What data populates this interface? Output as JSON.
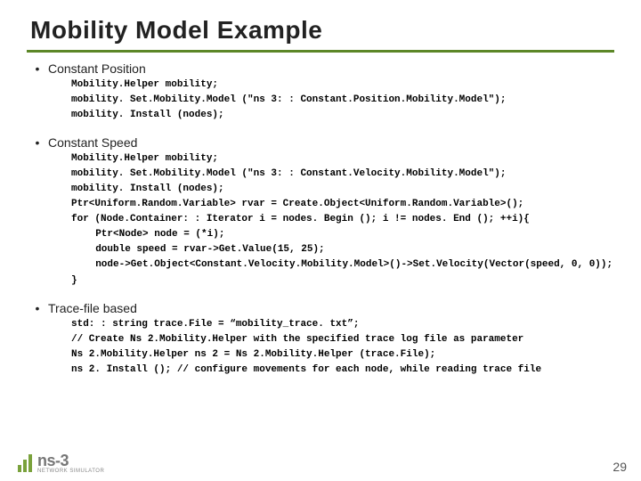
{
  "title": "Mobility Model Example",
  "sections": [
    {
      "label": "Constant Position",
      "code": [
        "Mobility.Helper mobility;",
        "mobility. Set.Mobility.Model (\"ns 3: : Constant.Position.Mobility.Model\");",
        "mobility. Install (nodes);"
      ]
    },
    {
      "label": "Constant Speed",
      "code": [
        "Mobility.Helper mobility;",
        "mobility. Set.Mobility.Model (\"ns 3: : Constant.Velocity.Mobility.Model\");",
        "mobility. Install (nodes);",
        "Ptr<Uniform.Random.Variable> rvar = Create.Object<Uniform.Random.Variable>();",
        "for (Node.Container: : Iterator i = nodes. Begin (); i != nodes. End (); ++i){",
        "  Ptr<Node> node = (*i);",
        "  double speed = rvar->Get.Value(15, 25);",
        "  node->Get.Object<Constant.Velocity.Mobility.Model>()->Set.Velocity(Vector(speed, 0, 0));",
        "}"
      ]
    },
    {
      "label": "Trace-file based",
      "code": [
        "std: : string trace.File = “mobility_trace. txt”;",
        "// Create Ns 2.Mobility.Helper with the specified trace log file as parameter",
        "Ns 2.Mobility.Helper ns 2 = Ns 2.Mobility.Helper (trace.File);",
        "ns 2. Install (); // configure movements for each node, while reading trace file"
      ]
    }
  ],
  "page_number": "29",
  "logo": {
    "text": "ns-3",
    "sub": "NETWORK SIMULATOR"
  }
}
